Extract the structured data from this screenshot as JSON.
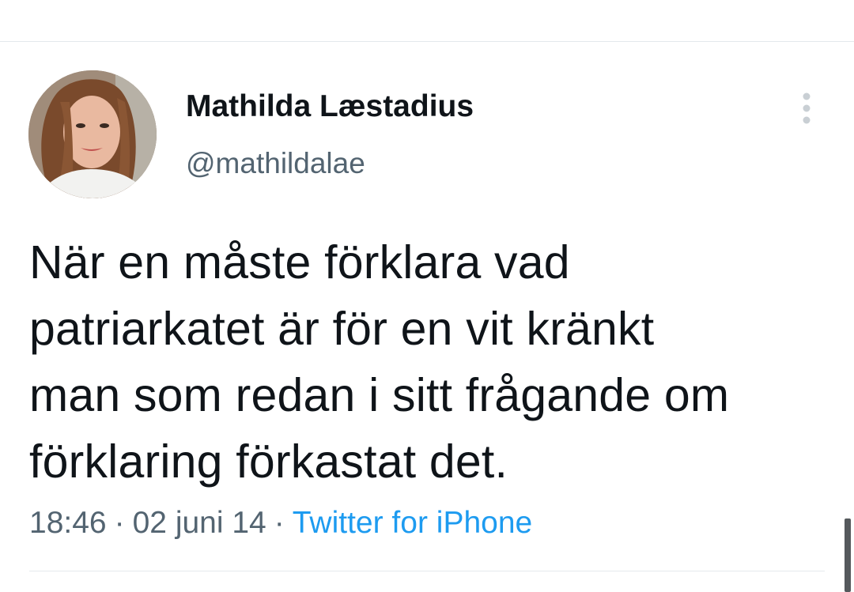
{
  "tweet": {
    "author": {
      "display_name": "Mathilda Læstadius",
      "handle": "@mathildalae"
    },
    "text_lines": [
      "När en måste förklara vad",
      "patriarkatet är för en vit kränkt",
      "man som redan i sitt frågande om",
      "förklaring förkastat det."
    ],
    "meta": {
      "time": "18:46",
      "separator": "·",
      "date": "02 juni 14",
      "source": "Twitter for iPhone"
    }
  },
  "icons": {
    "more": "vertical-ellipsis-icon"
  },
  "colors": {
    "text_primary": "#0f1419",
    "text_secondary": "#536471",
    "link": "#1d9bf0",
    "divider": "#e4e9ec",
    "more_icon": "#c9cfd4",
    "scrollbar": "#55595c"
  }
}
